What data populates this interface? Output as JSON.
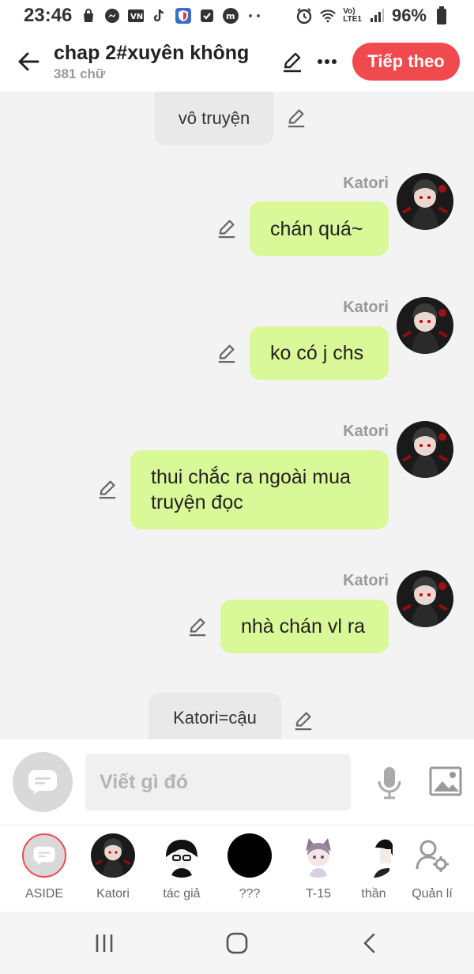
{
  "status_bar": {
    "time": "23:46",
    "battery": "96%",
    "icons": [
      "shopping-bag-icon",
      "messenger-icon",
      "vn-app-icon",
      "tiktok-icon",
      "shield-app-icon",
      "checkbox-icon",
      "m-app-icon",
      "more-dots-icon",
      "alarm-icon",
      "wifi-icon",
      "volte-lte-icon",
      "signal-icon",
      "battery-icon"
    ],
    "network_label_top": "Vo)",
    "network_label_bottom": "LTE1"
  },
  "header": {
    "title": "chap 2#xuyên không",
    "subtitle": "381 chữ",
    "next_label": "Tiếp theo",
    "accent_color": "#f04a4f"
  },
  "messages": [
    {
      "type": "aside",
      "text": "vô truyện"
    },
    {
      "type": "character",
      "sender": "Katori",
      "text": "chán quá~"
    },
    {
      "type": "character",
      "sender": "Katori",
      "text": "ko có j chs"
    },
    {
      "type": "character",
      "sender": "Katori",
      "text": "thui chắc ra ngoài mua truyện đọc"
    },
    {
      "type": "character",
      "sender": "Katori",
      "text": "nhà chán vl ra"
    },
    {
      "type": "aside",
      "text": "Katori=cậu"
    }
  ],
  "bubble_color": "#d9f897",
  "composer": {
    "placeholder": "Viết gì đó"
  },
  "characters": [
    {
      "name": "ASIDE",
      "icon": "chat-bubble-icon",
      "selected": true
    },
    {
      "name": "Katori",
      "icon": "avatar-katori"
    },
    {
      "name": "tác giả",
      "icon": "avatar-author"
    },
    {
      "name": "???",
      "icon": "avatar-black"
    },
    {
      "name": "T-15",
      "icon": "avatar-t15"
    },
    {
      "name": "thần",
      "icon": "avatar-than"
    },
    {
      "name": "Quản lí",
      "icon": "manage-user-icon"
    }
  ],
  "nav_bar": {
    "icons": [
      "recent-apps-icon",
      "home-icon",
      "back-icon"
    ]
  }
}
